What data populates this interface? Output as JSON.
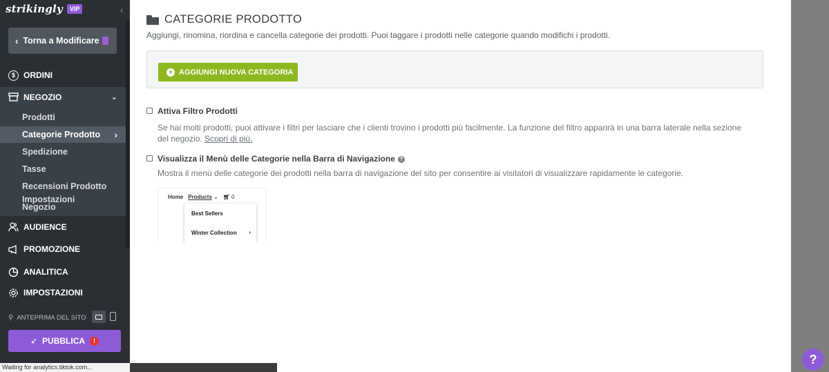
{
  "brand": {
    "logo": "strikingly",
    "badge": "VIP"
  },
  "sidebar": {
    "back_label": "Torna a Modificare",
    "orders": "ORDINI",
    "store": "NEGOZIO",
    "store_items": [
      {
        "label": "Prodotti"
      },
      {
        "label": "Categorie Prodotto"
      },
      {
        "label": "Spedizione"
      },
      {
        "label": "Tasse"
      },
      {
        "label": "Recensioni Prodotto"
      },
      {
        "label": "Impostazioni Negozio"
      }
    ],
    "audience": "AUDIENCE",
    "promotion": "PROMOZIONE",
    "analytics": "ANALITICA",
    "settings": "IMPOSTAZIONI",
    "preview_label": "ANTEPRIMA DEL SITO",
    "publish_label": "PUBBLICA"
  },
  "status_bar": {
    "text": "Waiting for analytics.tiktok.com..."
  },
  "main": {
    "title": "CATEGORIE PRODOTTO",
    "description": "Aggiungi, rinomina, riordina e cancella categorie dei prodotti. Puoi taggare i prodotti nelle categorie quando modifichi i prodotti.",
    "add_button": "AGGIUNGI NUOVA CATEGORIA",
    "filter_option": {
      "label": "Attiva Filtro Prodotti",
      "checked": false,
      "description": "Se hai molti prodotti, puoi attivare i filtri per lasciare che i clienti trovino i prodotti più facilmente. La funzione del filtro apparirà in una barra laterale nella sezione del negozio.",
      "link": "Scopri di più."
    },
    "menu_option": {
      "label": "Visualizza il Menù delle Categorie nella Barra di Navigazione",
      "checked": false,
      "description": "Mostra il menù delle categorie dei prodotti nella barra di navigazione del sito per consentire ai visitatori di visualizzare rapidamente le categorie."
    },
    "preview": {
      "home": "Home",
      "products": "Products",
      "cart_count": "0",
      "items": [
        "Best Sellers",
        "Winter Collection"
      ]
    }
  }
}
